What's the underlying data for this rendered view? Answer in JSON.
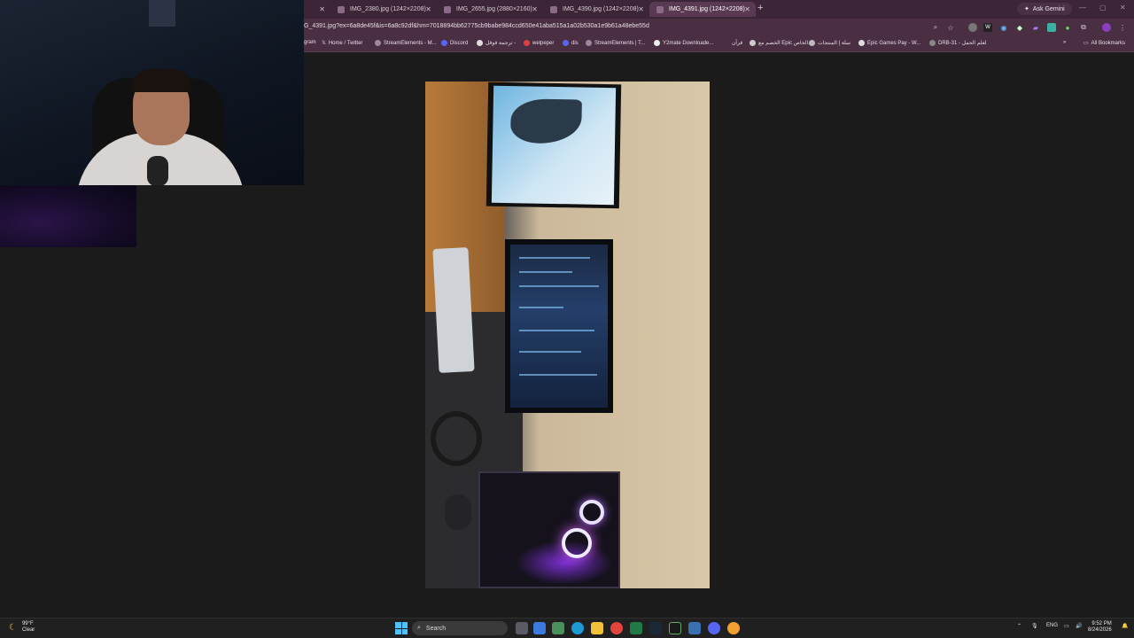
{
  "browser": {
    "tabs": [
      {
        "label": "IMG_2380.jpg (1242×2208)",
        "active": false
      },
      {
        "label": "IMG_2655.jpg (2880×2160)",
        "active": false
      },
      {
        "label": "IMG_4390.jpg (1242×2208)",
        "active": false
      },
      {
        "label": "IMG_4391.jpg (1242×2208)",
        "active": true
      }
    ],
    "new_tab": "+",
    "ask_gemini": "Ask Gemini",
    "url": "G_4391.jpg?ex=6a8de45f&is=6a8c92df&hm=7018894bb62775cb9babe984ccd650e41aba515a1a02b530a1e9b61a48ebe55d",
    "bookmarks": [
      "gram",
      "Home / Twitter",
      "StreamElements - M...",
      "Discord",
      "ترجمة قوقل -",
      "welpeper",
      "dis",
      "StreamElements | T...",
      "Y2mate Downloade...",
      "قرآن",
      "الخصم مع Epic الخاص...",
      "سلة | المنتجات",
      "Epic Games Pay - W...",
      "DRB-31 - لغلم الحمل"
    ],
    "all_bookmarks": "All Bookmarks",
    "more_bookmarks": "»"
  },
  "taskbar": {
    "weather_temp": "99°F",
    "weather_desc": "Clear",
    "search_placeholder": "Search",
    "lang": "ENG",
    "time": "9:52 PM",
    "date": "8/24/2026"
  },
  "colors": {
    "tabbar": "#3b2536",
    "toolbar": "#4a2f43",
    "viewport": "#1b1b1b",
    "taskbar": "#202020"
  }
}
